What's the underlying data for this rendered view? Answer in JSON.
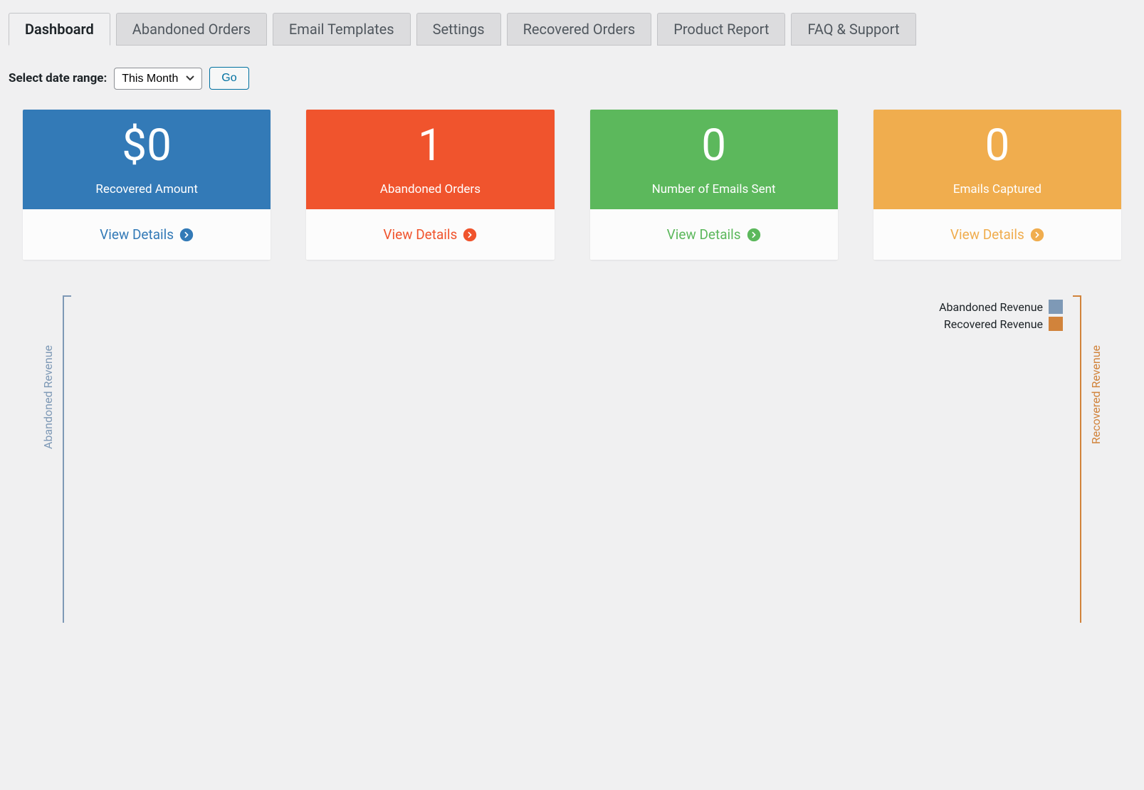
{
  "tabs": [
    {
      "label": "Dashboard",
      "active": true
    },
    {
      "label": "Abandoned Orders",
      "active": false
    },
    {
      "label": "Email Templates",
      "active": false
    },
    {
      "label": "Settings",
      "active": false
    },
    {
      "label": "Recovered Orders",
      "active": false
    },
    {
      "label": "Product Report",
      "active": false
    },
    {
      "label": "FAQ & Support",
      "active": false
    }
  ],
  "controls": {
    "label": "Select date range:",
    "selected": "This Month",
    "go_label": "Go"
  },
  "cards": [
    {
      "value": "$0",
      "label": "Recovered Amount",
      "link": "View Details",
      "color": "#337ab7"
    },
    {
      "value": "1",
      "label": "Abandoned Orders",
      "link": "View Details",
      "color": "#f0542d"
    },
    {
      "value": "0",
      "label": "Number of Emails Sent",
      "link": "View Details",
      "color": "#5cb85c"
    },
    {
      "value": "0",
      "label": "Emails Captured",
      "link": "View Details",
      "color": "#f0ad4e"
    }
  ],
  "chart_data": {
    "type": "line",
    "title": "",
    "y_left_label": "Abandoned Revenue",
    "y_right_label": "Recovered Revenue",
    "series": [
      {
        "name": "Abandoned Revenue",
        "color": "#7e99b6",
        "values": []
      },
      {
        "name": "Recovered Revenue",
        "color": "#d1833b",
        "values": []
      }
    ],
    "categories": [],
    "legend_position": "top-right"
  }
}
